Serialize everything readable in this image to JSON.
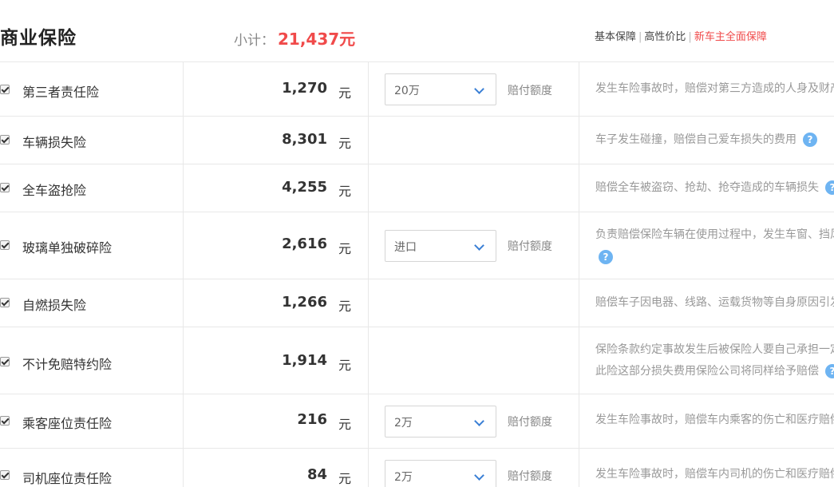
{
  "header": {
    "title": "商业保险",
    "subtotal_label": "小计：",
    "subtotal_value": "21,437元",
    "plans": [
      {
        "label": "基本保障",
        "active": false
      },
      {
        "label": "高性价比",
        "active": false
      },
      {
        "label": "新车主全面保障",
        "active": true
      }
    ]
  },
  "unit": "元",
  "select_label": "赔付额度",
  "help_glyph": "?",
  "items": [
    {
      "name": "第三者责任险",
      "price": "1,270",
      "select": "20万",
      "desc": "发生车险事故时，赔偿对第三方造成的人身及财产损失"
    },
    {
      "name": "车辆损失险",
      "price": "8,301",
      "select": "",
      "desc": "车子发生碰撞，赔偿自己爱车损失的费用"
    },
    {
      "name": "全车盗抢险",
      "price": "4,255",
      "select": "",
      "desc": "赔偿全车被盗窃、抢劫、抢夺造成的车辆损失"
    },
    {
      "name": "玻璃单独破碎险",
      "price": "2,616",
      "select": "进口",
      "desc": "负责赔偿保险车辆在使用过程中，发生车窗、挡风玻璃单独破碎"
    },
    {
      "name": "自燃损失险",
      "price": "1,266",
      "select": "",
      "desc": "赔偿车子因电器、线路、运载货物等自身原因引发"
    },
    {
      "name": "不计免赔特约险",
      "price": "1,914",
      "select": "",
      "desc_line1": "保险条款约定事故发生后被保险人要自己承担一定",
      "desc_line2": "此险这部分损失费用保险公司将同样给予赔偿"
    },
    {
      "name": "乘客座位责任险",
      "price": "216",
      "select": "2万",
      "desc": "发生车险事故时，赔偿车内乘客的伤亡和医疗赔偿"
    },
    {
      "name": "司机座位责任险",
      "price": "84",
      "select": "2万",
      "desc": "发生车险事故时，赔偿车内司机的伤亡和医疗赔偿"
    }
  ]
}
